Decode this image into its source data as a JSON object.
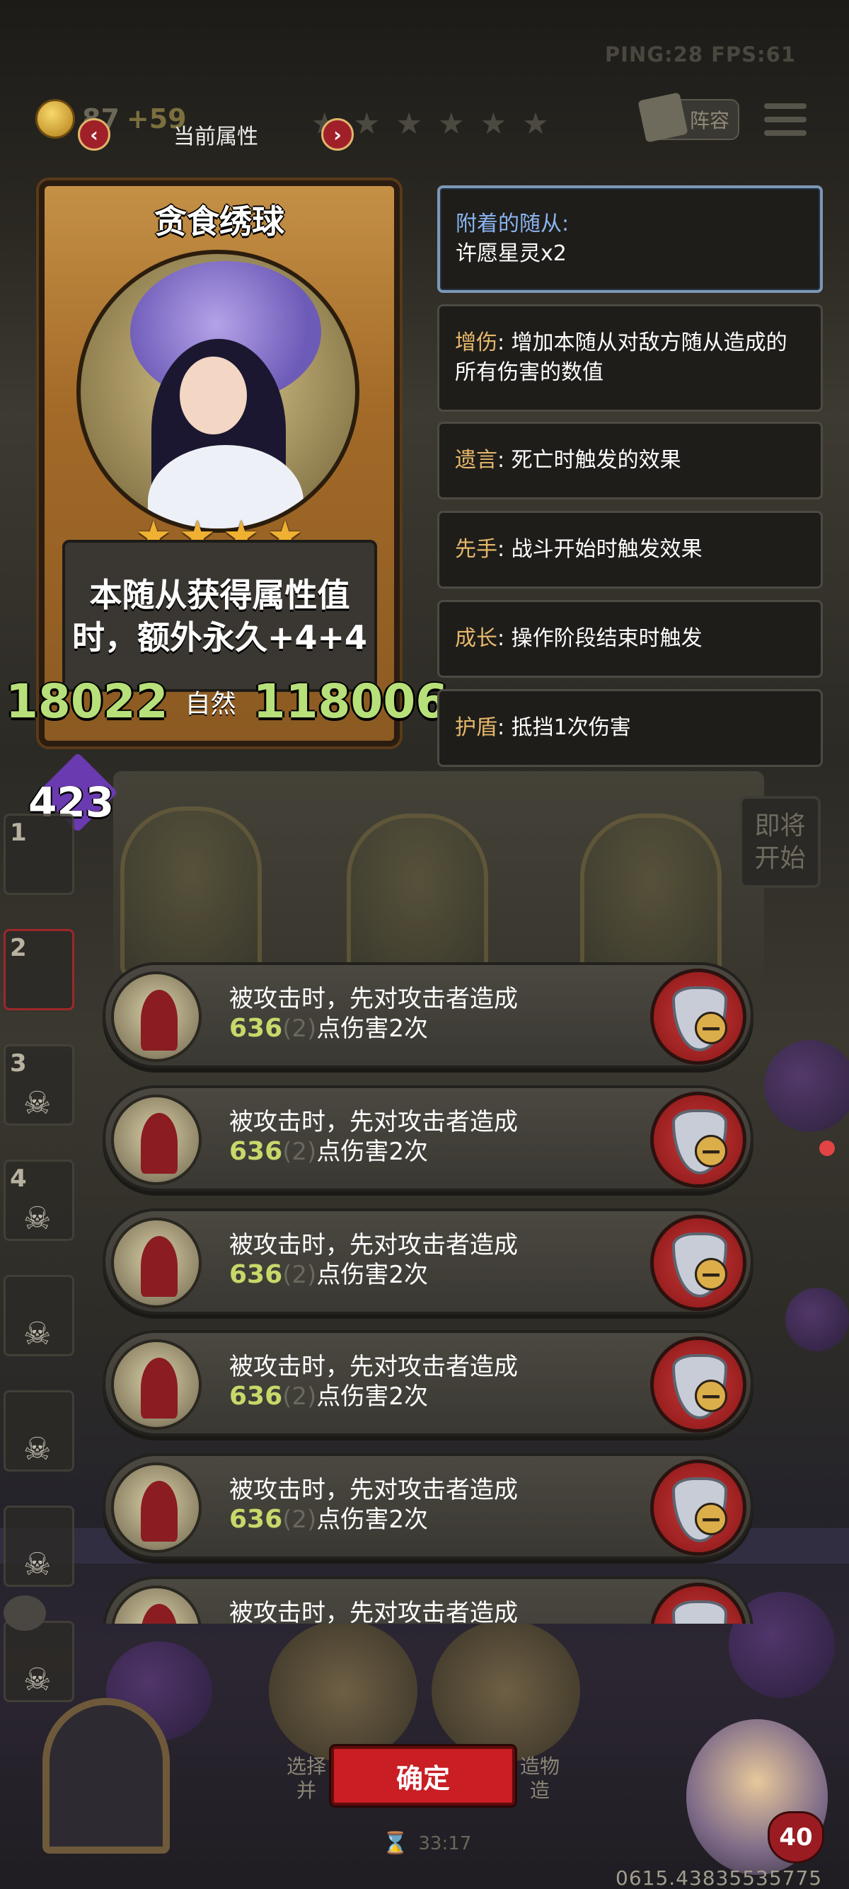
{
  "hud": {
    "ping_fps": "PING:28    FPS:61",
    "gold": "87",
    "gold_plus": "+59",
    "lineup_label": "阵容"
  },
  "attr_panel": {
    "title": "当前属性",
    "prev_arrow": "‹",
    "next_arrow": "›",
    "tier_stars": 6
  },
  "card": {
    "name": "贪食绣球",
    "stars": 4,
    "description_line1": "本随从获得属性值",
    "description_line2": "时，额外永久+4+4",
    "attack": "18022",
    "tribe": "自然",
    "health": "118006"
  },
  "info_list": [
    {
      "keyword": "附着的随从:",
      "text": "许愿星灵x2"
    },
    {
      "keyword": "增伤",
      "text": ": 增加本随从对敌方随从造成的所有伤害的数值"
    },
    {
      "keyword": "遗言",
      "text": ": 死亡时触发的效果"
    },
    {
      "keyword": "先手",
      "text": ": 战斗开始时触发效果"
    },
    {
      "keyword": "成长",
      "text": ": 操作阶段结束时触发"
    },
    {
      "keyword": "护盾",
      "text": ": 抵挡1次伤害"
    }
  ],
  "badge_value": "423",
  "start_soon": [
    "即将",
    "开始"
  ],
  "roster": [
    {
      "num": "1"
    },
    {
      "num": "2"
    },
    {
      "num": "3"
    },
    {
      "num": "4"
    },
    {
      "num": ""
    },
    {
      "num": ""
    },
    {
      "num": ""
    },
    {
      "num": ""
    }
  ],
  "effects": [
    {
      "line1": "被攻击时，先对攻击者造成",
      "value": "636",
      "dim": "(2)",
      "line2_suffix": "点伤害2次"
    },
    {
      "line1": "被攻击时，先对攻击者造成",
      "value": "636",
      "dim": "(2)",
      "line2_suffix": "点伤害2次"
    },
    {
      "line1": "被攻击时，先对攻击者造成",
      "value": "636",
      "dim": "(2)",
      "line2_suffix": "点伤害2次"
    },
    {
      "line1": "被攻击时，先对攻击者造成",
      "value": "636",
      "dim": "(2)",
      "line2_suffix": "点伤害2次"
    },
    {
      "line1": "被攻击时，先对攻击者造成",
      "value": "636",
      "dim": "(2)",
      "line2_suffix": "点伤害2次"
    },
    {
      "line1": "被攻击时，先对攻击者造成",
      "value": "",
      "dim": "",
      "line2_suffix": ""
    }
  ],
  "bottom": {
    "confirm_label": "确定",
    "hint_left": [
      "选择",
      "并"
    ],
    "hint_right": [
      "造物",
      "造"
    ],
    "timer": "33:17",
    "hp": "40",
    "build_id": "0615.43835535775"
  }
}
